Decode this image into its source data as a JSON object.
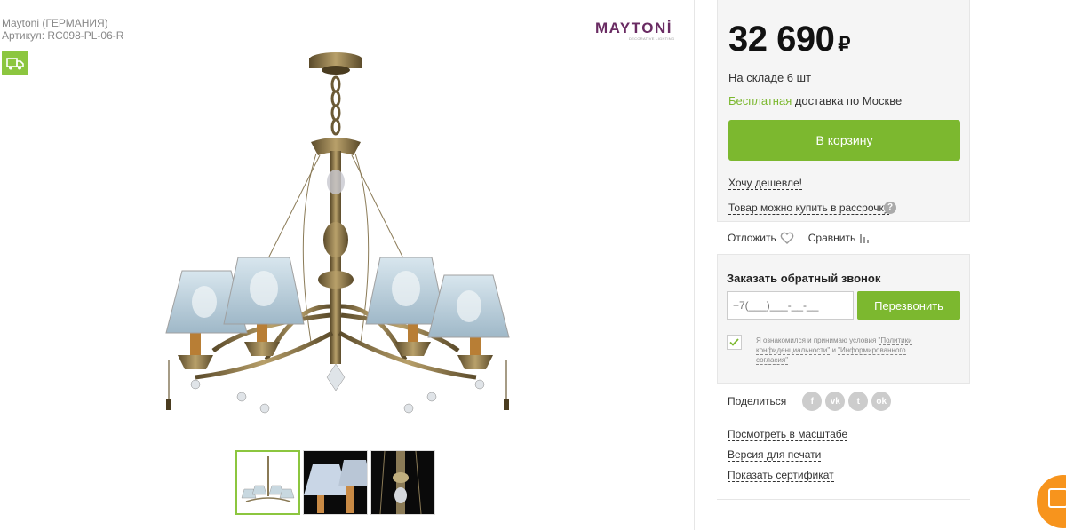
{
  "product": {
    "brand_line": "Maytoni (ГЕРМАНИЯ)",
    "sku_line": "Артикул: RC098-PL-06-R",
    "logo_text": "MAYTONİ",
    "logo_sub": "DECORATIVE LIGHTING"
  },
  "thumbnails": [
    {
      "alt": "chandelier-full-view",
      "active": true
    },
    {
      "alt": "shade-closeup",
      "active": false
    },
    {
      "alt": "detail-closeup",
      "active": false
    }
  ],
  "buy": {
    "price": "32 690",
    "currency": "₽",
    "stock": "На складе 6 шт",
    "delivery_free": "Бесплатная",
    "delivery_rest": " доставка по Москве",
    "cart_label": "В корзину",
    "cheaper_link": "Хочу дешевле!",
    "installment_link": "Товар можно купить в рассрочку",
    "help_glyph": "?"
  },
  "actions": {
    "postpone_label": "Отложить",
    "compare_label": "Сравнить"
  },
  "callback": {
    "title": "Заказать обратный звонок",
    "phone_placeholder": "+7(___)___-__-__",
    "recall_label": "Перезвонить",
    "consent_text": "Я ознакомился и принимаю условия ",
    "consent_link1": "\"Политики конфиденциальности\"",
    "consent_and": " и ",
    "consent_link2": "\"Информированного согласия\""
  },
  "share": {
    "label": "Поделиться",
    "networks": [
      {
        "name": "facebook",
        "glyph": "f"
      },
      {
        "name": "vkontakte",
        "glyph": "vk"
      },
      {
        "name": "twitter",
        "glyph": "t"
      },
      {
        "name": "odnoklassniki",
        "glyph": "ok"
      }
    ]
  },
  "links": {
    "zoom": "Посмотреть в масштабе",
    "print": "Версия для печати",
    "certificate": "Показать сертификат"
  },
  "colors": {
    "accent_green": "#7cb82f",
    "chat_orange": "#f7941d",
    "brand_purple": "#6a2c63"
  }
}
